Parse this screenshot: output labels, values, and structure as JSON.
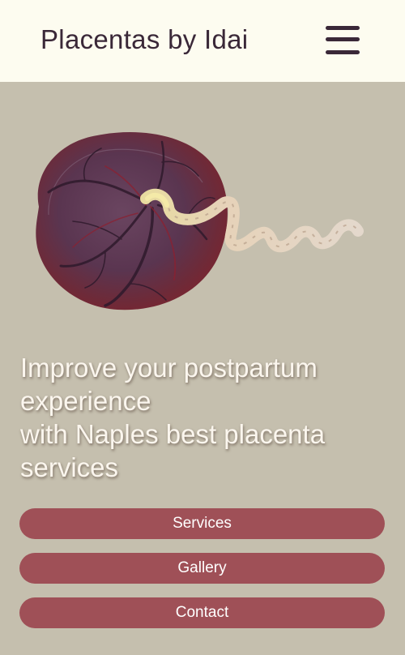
{
  "header": {
    "brand": "Placentas by Idai",
    "menu_icon": "hamburger-menu-icon"
  },
  "hero": {
    "image": "placenta-with-umbilical-cord-image",
    "headline_lines": [
      "Improve your postpartum",
      "experience",
      "with Naples best placenta",
      "services"
    ]
  },
  "nav_buttons": {
    "services": "Services",
    "gallery": "Gallery",
    "contact": "Contact"
  },
  "colors": {
    "page_background": "#c5bfae",
    "header_background": "#fdfcf0",
    "brand_text": "#3a2838",
    "button_background": "#9f5057",
    "button_text": "#ffffff",
    "headline_text": "#fbf6ee"
  }
}
